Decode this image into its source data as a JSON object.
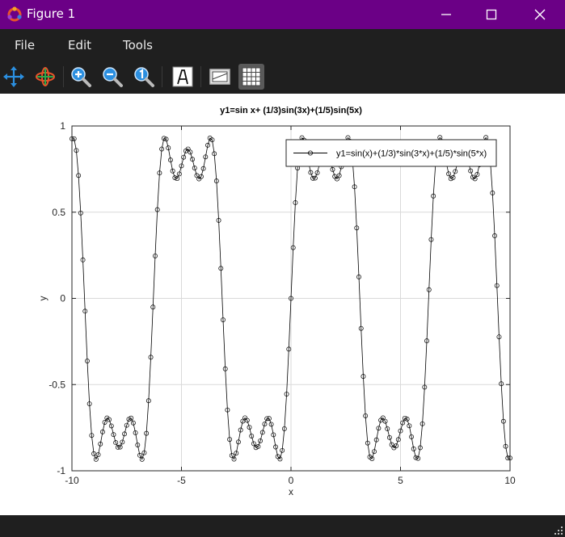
{
  "window": {
    "title": "Figure 1",
    "title_bar_color": "#6b0086",
    "controls": [
      "minimize-icon",
      "maximize-icon",
      "close-icon"
    ]
  },
  "menu": {
    "items": [
      "File",
      "Edit",
      "Tools"
    ]
  },
  "toolbar": {
    "tools": [
      {
        "icon": "pan-arrows-icon",
        "active": false
      },
      {
        "icon": "rotate-icon",
        "active": false
      },
      {
        "icon": "zoom-in-icon",
        "active": false
      },
      {
        "icon": "zoom-out-icon",
        "active": false
      },
      {
        "icon": "zoom-original-icon",
        "active": false
      },
      {
        "icon": "insert-text-icon",
        "active": false
      },
      {
        "icon": "axes-icon",
        "active": false
      },
      {
        "icon": "grid-icon",
        "active": true
      }
    ]
  },
  "chart_data": {
    "type": "line",
    "title": "y1=sin x+ (1/3)sin(3x)+(1/5)sin(5x)",
    "xlabel": "x",
    "ylabel": "y",
    "xlim": [
      -10,
      10
    ],
    "ylim": [
      -1,
      1
    ],
    "xticks": [
      "-10",
      "-5",
      "0",
      "5",
      "10"
    ],
    "yticks": [
      "-1",
      "-0.5",
      "0",
      "0.5",
      "1"
    ],
    "grid": true,
    "legend_position": "top-right",
    "series": [
      {
        "name": "y1=sin(x)+(1/3)*sin(3*x)+(1/5)*sin(5*x)",
        "color": "#000000",
        "marker": "circle",
        "function": "sin(x)+(1/3)*sin(3*x)+(1/5)*sin(5*x)",
        "x_start": -10,
        "x_end": 10,
        "num_points": 201
      }
    ]
  }
}
